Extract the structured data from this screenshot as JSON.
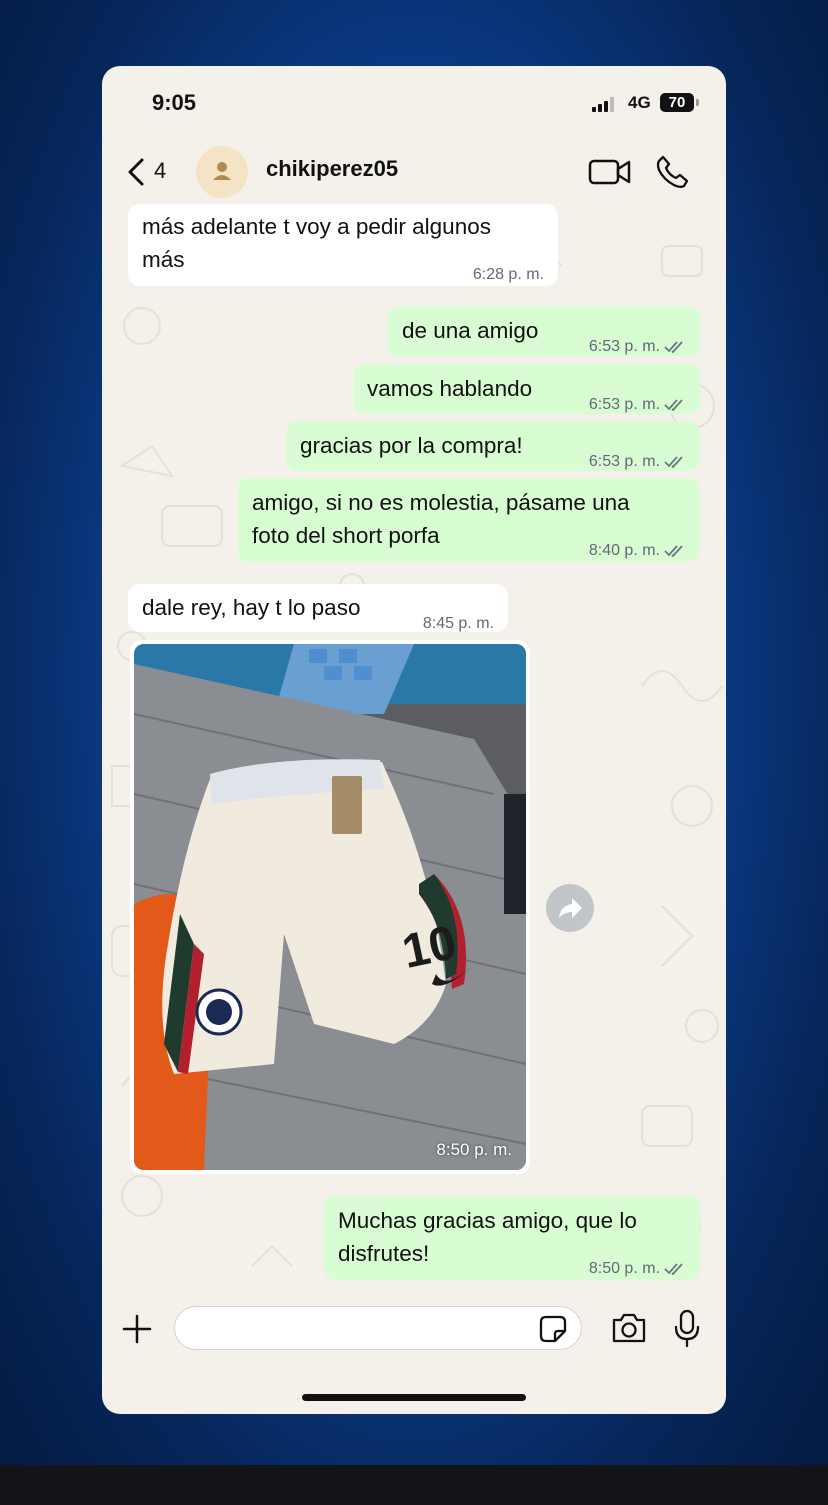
{
  "status": {
    "time": "9:05",
    "network": "4G",
    "battery": "70"
  },
  "header": {
    "back_count": "4",
    "contact_name": "chikiperez05"
  },
  "messages": [
    {
      "dir": "in",
      "line1": "más adelante t voy a pedir algunos",
      "line2": "más",
      "time": "6:28 p. m."
    },
    {
      "dir": "out",
      "text": "de una amigo",
      "time": "6:53 p. m.",
      "status": "read"
    },
    {
      "dir": "out",
      "text": "vamos hablando",
      "time": "6:53 p. m.",
      "status": "read"
    },
    {
      "dir": "out",
      "text": "gracias por la compra!",
      "time": "6:53 p. m.",
      "status": "read"
    },
    {
      "dir": "out",
      "line1": "amigo, si no es molestia, pásame una",
      "line2": "foto del short porfa",
      "time": "8:40 p. m.",
      "status": "read"
    },
    {
      "dir": "in",
      "text": "dale rey, hay t lo paso",
      "time": "8:45 p. m."
    },
    {
      "dir": "in",
      "type": "image",
      "image_number": "10",
      "time": "8:50 p. m."
    },
    {
      "dir": "out",
      "line1": "Muchas gracias amigo, que lo",
      "line2": "disfrutes!",
      "time": "8:50 p. m.",
      "status": "read"
    }
  ],
  "composer": {
    "placeholder": ""
  },
  "colors": {
    "wallpaper": "#f4f1ea",
    "incoming": "#ffffff",
    "outgoing": "#d9fdd3",
    "read_ticks": "#667781",
    "background": "#0c3f8f"
  },
  "icons": [
    "back-chevron-icon",
    "avatar-person-icon",
    "video-call-icon",
    "phone-call-icon",
    "forward-icon",
    "plus-icon",
    "sticker-icon",
    "camera-icon",
    "microphone-icon"
  ]
}
